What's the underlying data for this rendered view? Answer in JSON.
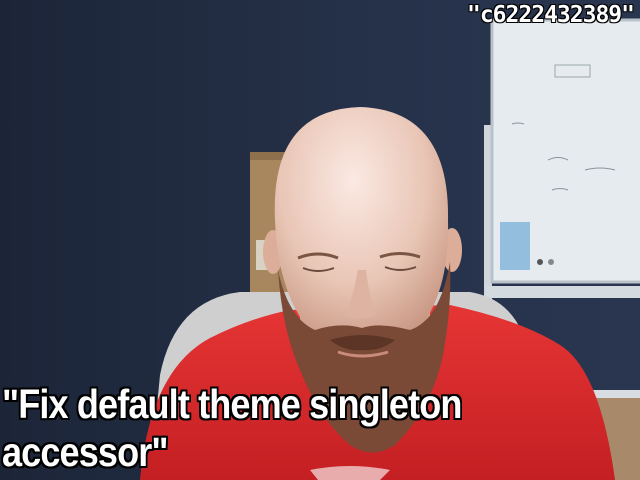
{
  "captions": {
    "top": "\"c6222432389\"",
    "bottom": "\"Fix default theme singleton accessor\""
  },
  "colors": {
    "wall": "#1f2a3d",
    "shirt": "#d42a2a",
    "skin": "#e7c3b3",
    "beard": "#7a4a36",
    "whiteboard": "#e9eef2",
    "caption_text": "#ffffff",
    "caption_outline": "#000000"
  }
}
